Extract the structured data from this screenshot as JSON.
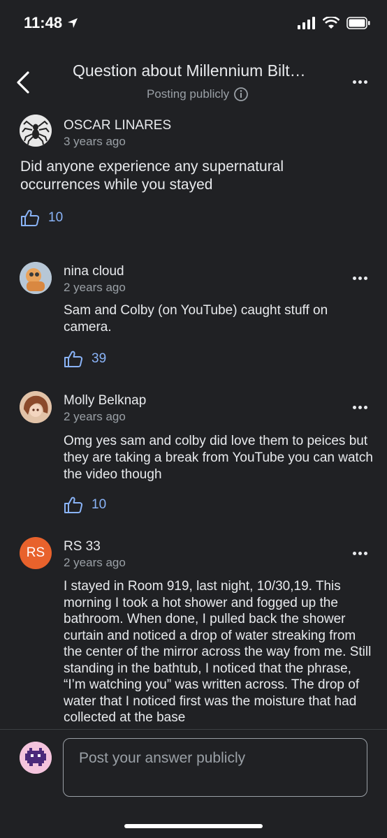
{
  "status": {
    "time": "11:48"
  },
  "header": {
    "title": "Question about Millennium Bilt…",
    "subtitle": "Posting publicly"
  },
  "question": {
    "author": "OSCAR LINARES",
    "time": "3 years ago",
    "text": "Did anyone experience any supernatural occurrences while you stayed",
    "likes": "10"
  },
  "replies": [
    {
      "author": "nina cloud",
      "time": "2 years ago",
      "text": "Sam and Colby (on YouTube) caught stuff on camera.",
      "likes": "39"
    },
    {
      "author": "Molly Belknap",
      "time": "2 years ago",
      "text": "Omg yes sam and colby did love them to peices but they are taking a break from YouTube you can watch the video though",
      "likes": "10"
    },
    {
      "author": "RS 33",
      "avatar_initials": "RS",
      "time": "2 years ago",
      "text": "I stayed in Room 919, last night, 10/30,19. This morning I took a hot shower and fogged up the bathroom. When done, I pulled back the shower curtain and noticed a drop of water streaking from the center of the mirror across the way from me. Still standing in the bathtub, I noticed that the phrase, “I’m watching you” was written across. The drop of water that I noticed first was the moisture that had collected at the base"
    }
  ],
  "composer": {
    "placeholder": "Post your answer publicly"
  },
  "colors": {
    "accent": "#8ab4f8",
    "background": "#202124",
    "rs_avatar": "#e8622c"
  }
}
